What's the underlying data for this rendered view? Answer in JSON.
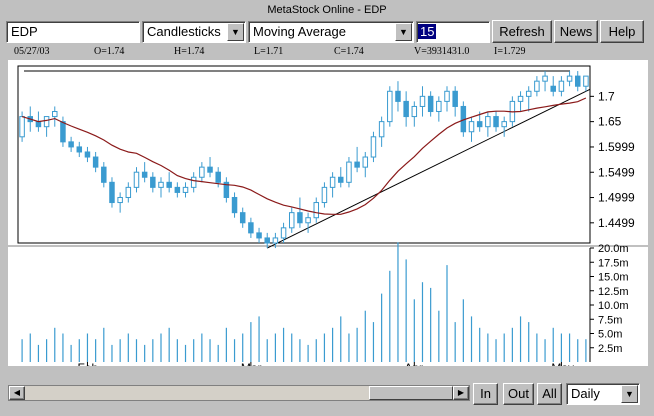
{
  "window": {
    "title": "MetaStock Online - EDP"
  },
  "toolbar": {
    "symbol": "EDP",
    "chart_style": "Candlesticks",
    "indicator": "Moving Average",
    "period": "15",
    "buttons": [
      "Refresh",
      "News",
      "Help"
    ]
  },
  "quote": {
    "date": "05/27/03",
    "open": "O=1.74",
    "high": "H=1.74",
    "low": "L=1.71",
    "close": "C=1.74",
    "volume": "V=3931431.0",
    "indicator": "I=1.729"
  },
  "price_axis": [
    "1.7",
    "1.65",
    "1.5999",
    "1.5499",
    "1.4999",
    "1.4499"
  ],
  "volume_axis": [
    "20.0m",
    "17.5m",
    "15.0m",
    "12.5m",
    "10.0m",
    "7.5m",
    "5.0m",
    "2.5m"
  ],
  "months": [
    "Feb",
    "Mar",
    "Apr",
    "May"
  ],
  "bottom": {
    "zoom_in": "In",
    "zoom_out": "Out",
    "all": "All",
    "interval": "Daily"
  },
  "colors": {
    "candle": "#3a9bd0",
    "ma": "#8b1a1a",
    "trendline": "#000000",
    "volume": "#3a9bd0"
  },
  "chart_data": {
    "type": "candlestick",
    "series": [
      {
        "name": "EDP",
        "values": [
          [
            1.62,
            1.67,
            1.61,
            1.66
          ],
          [
            1.66,
            1.68,
            1.63,
            1.65
          ],
          [
            1.65,
            1.67,
            1.63,
            1.64
          ],
          [
            1.64,
            1.66,
            1.62,
            1.66
          ],
          [
            1.66,
            1.68,
            1.64,
            1.67
          ],
          [
            1.65,
            1.66,
            1.6,
            1.61
          ],
          [
            1.61,
            1.62,
            1.59,
            1.6
          ],
          [
            1.6,
            1.61,
            1.58,
            1.59
          ],
          [
            1.59,
            1.6,
            1.57,
            1.58
          ],
          [
            1.58,
            1.59,
            1.55,
            1.56
          ],
          [
            1.56,
            1.57,
            1.52,
            1.53
          ],
          [
            1.53,
            1.54,
            1.48,
            1.49
          ],
          [
            1.49,
            1.51,
            1.47,
            1.5
          ],
          [
            1.5,
            1.53,
            1.49,
            1.52
          ],
          [
            1.52,
            1.56,
            1.51,
            1.55
          ],
          [
            1.55,
            1.57,
            1.53,
            1.54
          ],
          [
            1.54,
            1.55,
            1.51,
            1.52
          ],
          [
            1.52,
            1.54,
            1.5,
            1.53
          ],
          [
            1.53,
            1.55,
            1.51,
            1.52
          ],
          [
            1.52,
            1.53,
            1.5,
            1.51
          ],
          [
            1.51,
            1.53,
            1.5,
            1.52
          ],
          [
            1.52,
            1.55,
            1.51,
            1.54
          ],
          [
            1.54,
            1.57,
            1.53,
            1.56
          ],
          [
            1.56,
            1.58,
            1.54,
            1.55
          ],
          [
            1.55,
            1.56,
            1.52,
            1.53
          ],
          [
            1.53,
            1.54,
            1.49,
            1.5
          ],
          [
            1.5,
            1.51,
            1.46,
            1.47
          ],
          [
            1.47,
            1.48,
            1.44,
            1.45
          ],
          [
            1.45,
            1.46,
            1.42,
            1.43
          ],
          [
            1.43,
            1.44,
            1.41,
            1.42
          ],
          [
            1.42,
            1.43,
            1.4,
            1.41
          ],
          [
            1.41,
            1.43,
            1.4,
            1.42
          ],
          [
            1.42,
            1.45,
            1.41,
            1.44
          ],
          [
            1.44,
            1.48,
            1.43,
            1.47
          ],
          [
            1.47,
            1.5,
            1.44,
            1.45
          ],
          [
            1.45,
            1.47,
            1.43,
            1.46
          ],
          [
            1.46,
            1.5,
            1.45,
            1.49
          ],
          [
            1.49,
            1.53,
            1.48,
            1.52
          ],
          [
            1.52,
            1.55,
            1.5,
            1.54
          ],
          [
            1.54,
            1.56,
            1.52,
            1.53
          ],
          [
            1.53,
            1.58,
            1.52,
            1.57
          ],
          [
            1.57,
            1.6,
            1.55,
            1.56
          ],
          [
            1.56,
            1.59,
            1.54,
            1.58
          ],
          [
            1.58,
            1.63,
            1.57,
            1.62
          ],
          [
            1.62,
            1.66,
            1.6,
            1.65
          ],
          [
            1.65,
            1.72,
            1.64,
            1.71
          ],
          [
            1.71,
            1.73,
            1.67,
            1.69
          ],
          [
            1.69,
            1.71,
            1.64,
            1.66
          ],
          [
            1.66,
            1.69,
            1.64,
            1.68
          ],
          [
            1.68,
            1.72,
            1.66,
            1.7
          ],
          [
            1.7,
            1.71,
            1.66,
            1.67
          ],
          [
            1.67,
            1.7,
            1.65,
            1.69
          ],
          [
            1.69,
            1.72,
            1.67,
            1.71
          ],
          [
            1.71,
            1.72,
            1.66,
            1.68
          ],
          [
            1.68,
            1.69,
            1.62,
            1.63
          ],
          [
            1.63,
            1.66,
            1.61,
            1.65
          ],
          [
            1.65,
            1.67,
            1.63,
            1.64
          ],
          [
            1.64,
            1.67,
            1.62,
            1.66
          ],
          [
            1.66,
            1.67,
            1.63,
            1.64
          ],
          [
            1.64,
            1.66,
            1.62,
            1.65
          ],
          [
            1.65,
            1.7,
            1.64,
            1.69
          ],
          [
            1.69,
            1.71,
            1.67,
            1.7
          ],
          [
            1.7,
            1.72,
            1.67,
            1.71
          ],
          [
            1.71,
            1.74,
            1.7,
            1.73
          ],
          [
            1.73,
            1.75,
            1.71,
            1.74
          ],
          [
            1.72,
            1.74,
            1.7,
            1.71
          ],
          [
            1.71,
            1.74,
            1.7,
            1.73
          ],
          [
            1.73,
            1.75,
            1.72,
            1.74
          ],
          [
            1.74,
            1.75,
            1.71,
            1.72
          ],
          [
            1.72,
            1.74,
            1.71,
            1.74
          ]
        ]
      }
    ],
    "volume": [
      4,
      5,
      3,
      4,
      6,
      5,
      3,
      4,
      5,
      4,
      6,
      3,
      4,
      5,
      4,
      3,
      4,
      5,
      6,
      4,
      3,
      4,
      5,
      4,
      3,
      6,
      4,
      5,
      7,
      8,
      4,
      5,
      6,
      5,
      4,
      3,
      4,
      5,
      6,
      8,
      5,
      6,
      9,
      7,
      12,
      16,
      21,
      18,
      11,
      14,
      13,
      9,
      17,
      7,
      11,
      8,
      6,
      5,
      4,
      5,
      6,
      8,
      7,
      5,
      4,
      6,
      5,
      5,
      4,
      4
    ],
    "moving_average": {
      "period": 15
    },
    "ylim": [
      1.41,
      1.76
    ],
    "volume_ylim": [
      0,
      20
    ],
    "xlabel": "",
    "ylabel": ""
  }
}
